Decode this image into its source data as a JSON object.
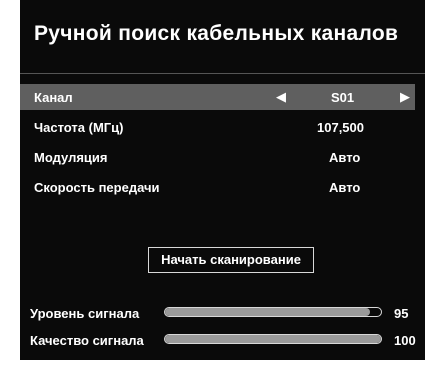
{
  "screen": {
    "title": "Ручной поиск кабельных каналов"
  },
  "rows": {
    "channel": {
      "label": "Канал",
      "value": "S01",
      "left_arrow": "◀",
      "right_arrow": "▶"
    },
    "frequency": {
      "label": "Частота (МГц)",
      "value": "107,500"
    },
    "modulation": {
      "label": "Модуляция",
      "value": "Авто"
    },
    "symbol_rate": {
      "label": "Скорость передачи",
      "value": "Авто"
    }
  },
  "scan_button": {
    "label": "Начать сканирование"
  },
  "meters": {
    "signal_level": {
      "label": "Уровень сигнала",
      "value": "95",
      "fraction": 0.95
    },
    "signal_quality": {
      "label": "Качество сигнала",
      "value": "100",
      "fraction": 1.0
    }
  },
  "colors": {
    "background": "#0a0a0a",
    "selected_row": "#5f5f5f",
    "bar_fill": "#9a9a9a",
    "text": "#ffffff"
  }
}
